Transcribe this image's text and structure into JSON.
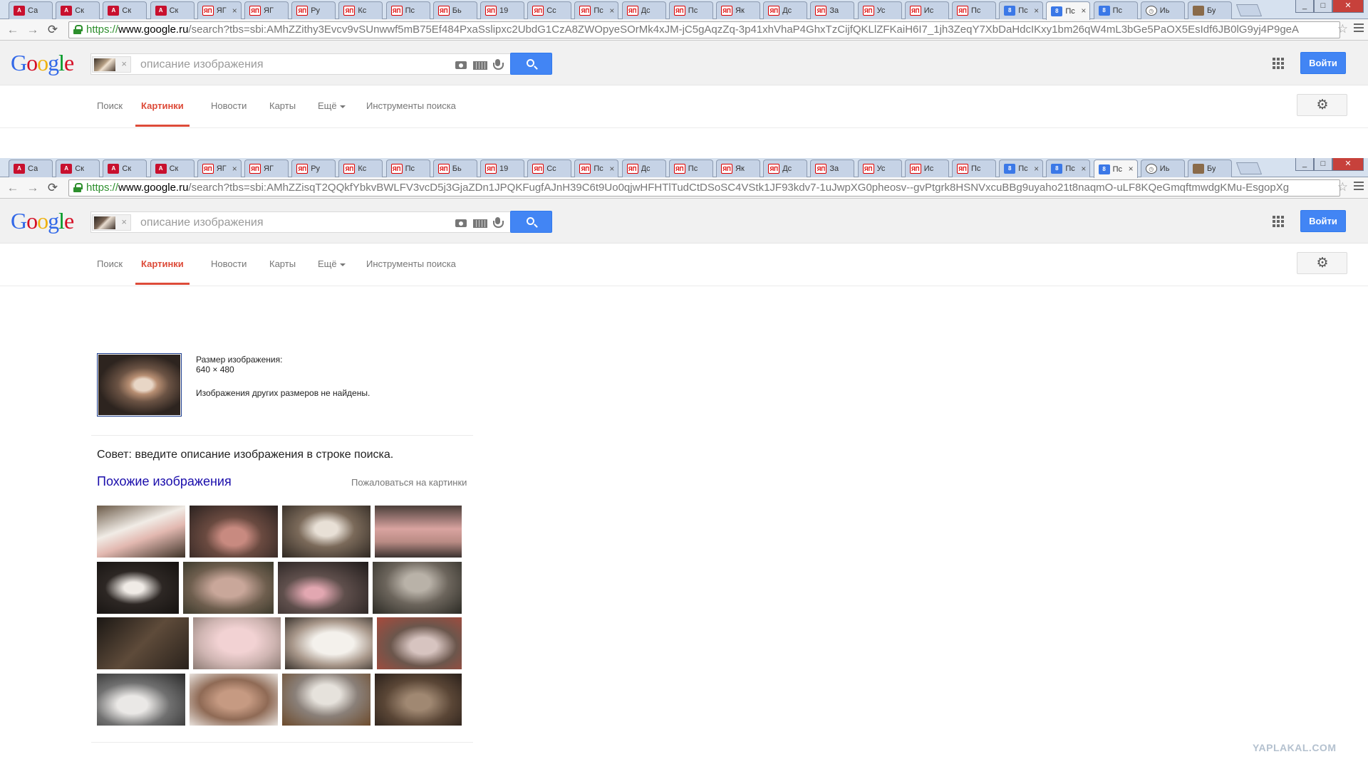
{
  "browser": {
    "tabs": [
      {
        "favicon": "ac-red",
        "label": "Са",
        "closable": false
      },
      {
        "favicon": "ac-red",
        "label": "Ск",
        "closable": false
      },
      {
        "favicon": "ac-red",
        "label": "Ск",
        "closable": false
      },
      {
        "favicon": "ac-red",
        "label": "Ск",
        "closable": false
      },
      {
        "favicon": "yap",
        "label": "ЯГ",
        "closable": true
      },
      {
        "favicon": "yap",
        "label": "ЯГ",
        "closable": false
      },
      {
        "favicon": "yap",
        "label": "Ру",
        "closable": false
      },
      {
        "favicon": "yap",
        "label": "Кс",
        "closable": false
      },
      {
        "favicon": "yap",
        "label": "Пс",
        "closable": false
      },
      {
        "favicon": "yap",
        "label": "Бь",
        "closable": false
      },
      {
        "favicon": "yap",
        "label": "19",
        "closable": false
      },
      {
        "favicon": "yap",
        "label": "Сс",
        "closable": false
      },
      {
        "favicon": "yap",
        "label": "Пс",
        "closable": true
      },
      {
        "favicon": "yap",
        "label": "Дс",
        "closable": false
      },
      {
        "favicon": "yap",
        "label": "Пс",
        "closable": false
      },
      {
        "favicon": "yap",
        "label": "Як",
        "closable": false
      },
      {
        "favicon": "yap",
        "label": "Дс",
        "closable": false
      },
      {
        "favicon": "yap",
        "label": "За",
        "closable": false
      },
      {
        "favicon": "yap",
        "label": "Ус",
        "closable": false
      },
      {
        "favicon": "yap",
        "label": "Ис",
        "closable": false
      },
      {
        "favicon": "yap",
        "label": "Пс",
        "closable": false
      },
      {
        "favicon": "g",
        "label": "Пс",
        "closable": true
      },
      {
        "favicon": "g",
        "label": "Пс",
        "closable": true
      },
      {
        "favicon": "g",
        "label": "Пс",
        "closable": false
      },
      {
        "favicon": "clock",
        "label": "Иь",
        "closable": false
      },
      {
        "favicon": "img",
        "label": "Бу",
        "closable": false
      }
    ],
    "window_controls": [
      "_",
      "□",
      "✕"
    ],
    "nav_back": "←",
    "nav_forward": "→",
    "nav_reload": "⟳",
    "star": "☆",
    "shot1": {
      "active_tab": 22,
      "url_scheme": "https://",
      "url_host": "www.google.ru",
      "url_rest": "/search?tbs=sbi:AMhZZithy3Evcv9vSUnwwf5mB75Ef484PxaSslipxc2UbdG1CzA8ZWOpyeSOrMk4xJM-jC5gAqzZq-3p41xhVhaP4GhxTzCijfQKLlZFKaiH6I7_1jh3ZeqY7XbDaHdcIKxy1bm26qW4mL3bGe5PaOX5EsIdf6JB0lG9yj4P9geA"
    },
    "shot2": {
      "active_tab": 23,
      "url_scheme": "https://",
      "url_host": "www.google.ru",
      "url_rest": "/search?tbs=sbi:AMhZZisqT2QQkfYbkvBWLFV3vcD5j3GjaZDn1JPQKFugfAJnH39C6t9Uo0qjwHFHTlTudCtDSoSC4VStk1JF93kdv7-1uJwpXG0pheosv--gvPtgrk8HSNVxcuBBg9uyaho21t8naqmO-uLF8KQeGmqftmwdgKMu-EsgopXg"
    }
  },
  "google": {
    "logo": [
      "G",
      "o",
      "o",
      "g",
      "l",
      "e"
    ],
    "logo_colors": [
      "#3369e8",
      "#d50f25",
      "#eeb211",
      "#3369e8",
      "#009925",
      "#d50f25"
    ],
    "search_placeholder": "описание изображения",
    "chip_close": "×",
    "signin_label": "Войти",
    "nav_tabs": [
      {
        "label": "Поиск",
        "active": false
      },
      {
        "label": "Картинки",
        "active": true
      },
      {
        "label": "Новости",
        "active": false
      },
      {
        "label": "Карты",
        "active": false
      },
      {
        "label": "Ещё",
        "active": false,
        "dropdown": true
      },
      {
        "label": "Инструменты поиска",
        "active": false
      }
    ],
    "settings_icon": "⚙"
  },
  "result": {
    "size_label": "Размер изображения:",
    "size_value": "640 × 480",
    "no_other_sizes": "Изображения других размеров не найдены.",
    "tip": "Совет: введите описание изображения в строке поиска.",
    "similar_title": "Похожие изображения",
    "report_label": "Пожаловаться на картинки",
    "similar_images": [
      [
        "calf",
        "mole-rat",
        "ferret",
        "piglet"
      ],
      [
        "rat",
        "pig",
        "two-pigs",
        "koala"
      ],
      [
        "aye-aye",
        "piglet-pink",
        "white-fox",
        "possum"
      ],
      [
        "opossum",
        "sleeping-pups",
        "koala-tree",
        "hedgehog"
      ]
    ]
  },
  "watermark": "YAPLAKAL.COM"
}
